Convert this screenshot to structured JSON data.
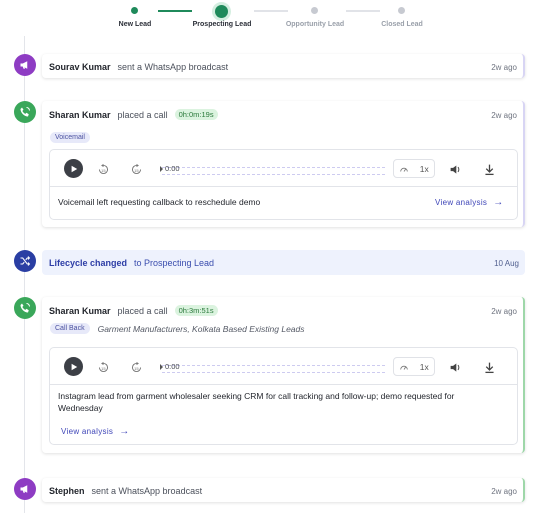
{
  "stepper": {
    "steps": [
      {
        "label": "New Lead",
        "state": "done"
      },
      {
        "label": "Prospecting Lead",
        "state": "current"
      },
      {
        "label": "Opportunity Lead",
        "state": "pending"
      },
      {
        "label": "Closed Lead",
        "state": "pending"
      }
    ],
    "colors": {
      "done": "#1f8a5b",
      "current": "#1f8a5b",
      "pending": "#c7cad1",
      "label_pending": "#9aa0aa",
      "label_active": "#2b2f38"
    }
  },
  "timeline": [
    {
      "type": "whatsapp",
      "icon": "megaphone-icon",
      "icon_color": "#8e3cc3",
      "actor": "Sourav Kumar",
      "action": "sent a WhatsApp broadcast",
      "time": "2w ago"
    },
    {
      "type": "call",
      "icon": "phone-call-icon",
      "icon_color": "#3aa75a",
      "actor": "Sharan Kumar",
      "action": "placed a call",
      "duration": "0h:0m:19s",
      "time": "2w ago",
      "tag": "Voicemail",
      "tag_desc": "",
      "player": {
        "timecode": "0:00",
        "speed": "1x",
        "rewind_label": "15",
        "forward_label": "15"
      },
      "summary": "Voicemail left requesting callback to reschedule demo",
      "link": "View analysis"
    },
    {
      "type": "lifecycle",
      "icon": "shuffle-icon",
      "icon_color": "#2a3ea3",
      "label": "Lifecycle changed",
      "text": "to Prospecting Lead",
      "time": "10 Aug"
    },
    {
      "type": "call",
      "icon": "phone-call-icon",
      "icon_color": "#3aa75a",
      "actor": "Sharan Kumar",
      "action": "placed a call",
      "duration": "0h:3m:51s",
      "time": "2w ago",
      "tag": "Call Back",
      "tag_desc": "Garment Manufacturers, Kolkata Based Existing Leads",
      "player": {
        "timecode": "0:00",
        "speed": "1x",
        "rewind_label": "15",
        "forward_label": "15"
      },
      "summary": "Instagram lead from garment wholesaler seeking CRM for call tracking and follow-up; demo requested for Wednesday",
      "link": "View analysis"
    },
    {
      "type": "whatsapp",
      "icon": "megaphone-icon",
      "icon_color": "#8e3cc3",
      "actor": "Stephen",
      "action": "sent a WhatsApp broadcast",
      "time": "2w ago"
    }
  ]
}
